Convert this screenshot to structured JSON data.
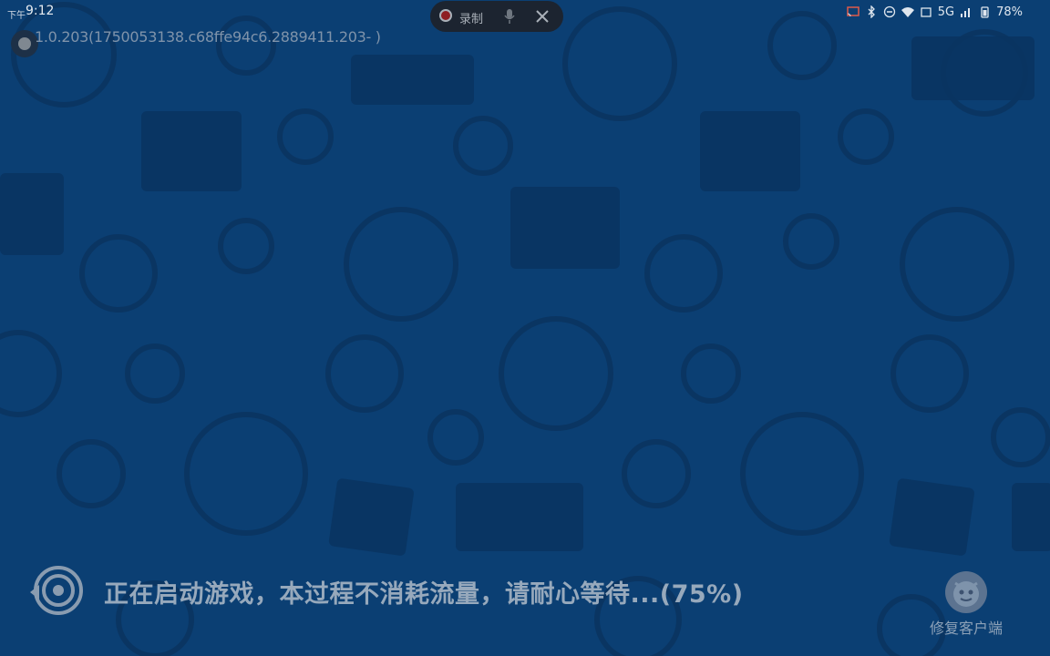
{
  "status_bar": {
    "time_prefix": "下午",
    "time": "9:12",
    "network": "5G",
    "battery": "78%"
  },
  "recording": {
    "label": "录制"
  },
  "version_text": "1.0.203(1750053138.c68ffe94c6.2889411.203- )",
  "loading": {
    "message": "正在启动游戏，本过程不消耗流量，请耐心等待...(75%)",
    "progress_percent": 75
  },
  "repair": {
    "label": "修复客户端"
  },
  "colors": {
    "background": "#0b3f73",
    "pattern": "#0a3565",
    "text_dim": "#97a9bc"
  }
}
